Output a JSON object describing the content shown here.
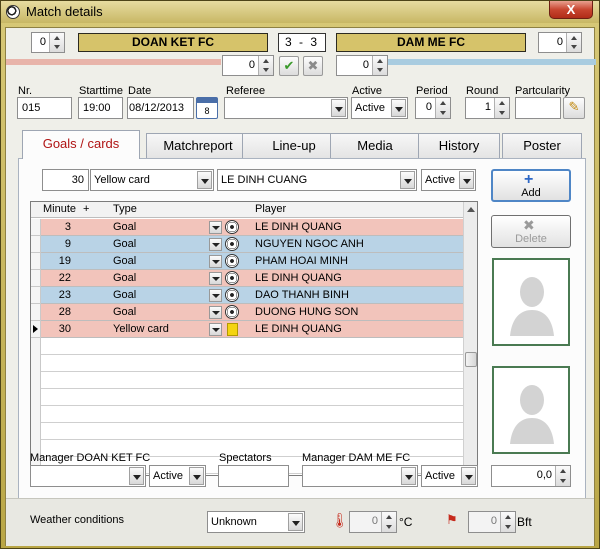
{
  "window": {
    "title": "Match details",
    "close_label": "X"
  },
  "score": {
    "home_team": "DOAN KET FC",
    "away_team": "DAM ME FC",
    "score_text": "3 - 3",
    "home_left_spin": "0",
    "home_sub_spin": "0",
    "away_sub_spin": "0",
    "away_right_spin": "0"
  },
  "info": {
    "nr_label": "Nr.",
    "nr_value": "015",
    "starttime_label": "Starttime",
    "starttime_value": "19:00",
    "date_label": "Date",
    "date_value": "08/12/2013",
    "calendar_badge": "8",
    "referee_label": "Referee",
    "referee_value": "",
    "active_label": "Active",
    "active_value": "Active",
    "period_label": "Period",
    "period_value": "0",
    "round_label": "Round",
    "round_value": "1",
    "particularity_label": "Partcularity",
    "particularity_value": ""
  },
  "tabs": [
    {
      "label": "Goals / cards",
      "active": true
    },
    {
      "label": "Matchreport",
      "active": false
    },
    {
      "label": "Line-up",
      "active": false
    },
    {
      "label": "Media",
      "active": false
    },
    {
      "label": "History",
      "active": false
    },
    {
      "label": "Poster",
      "active": false
    }
  ],
  "entry": {
    "minute": "30",
    "type": "Yellow card",
    "player": "LE DINH CUANG",
    "status": "Active"
  },
  "buttons": {
    "add": "Add",
    "delete": "Delete"
  },
  "grid": {
    "headers": {
      "minute": "Minute",
      "plus": "+",
      "type": "Type",
      "player": "Player"
    },
    "rows": [
      {
        "minute": "3",
        "type": "Goal",
        "player": "LE DINH QUANG",
        "team": "home",
        "icon": "ball"
      },
      {
        "minute": "9",
        "type": "Goal",
        "player": "NGUYEN NGOC ANH",
        "team": "away",
        "icon": "ball"
      },
      {
        "minute": "19",
        "type": "Goal",
        "player": "PHAM HOAI MINH",
        "team": "away",
        "icon": "ball"
      },
      {
        "minute": "22",
        "type": "Goal",
        "player": "LE DINH QUANG",
        "team": "home",
        "icon": "ball"
      },
      {
        "minute": "23",
        "type": "Goal",
        "player": "DAO THANH BINH",
        "team": "away",
        "icon": "ball"
      },
      {
        "minute": "28",
        "type": "Goal",
        "player": "DUONG HUNG SON",
        "team": "home",
        "icon": "ball"
      },
      {
        "minute": "30",
        "type": "Yellow card",
        "player": "LE DINH QUANG",
        "team": "home",
        "icon": "yellow-card",
        "current": true
      }
    ]
  },
  "bottom": {
    "manager_home_label": "Manager DOAN KET FC",
    "manager_home_value": "",
    "manager_home_status": "Active",
    "spectators_label": "Spectators",
    "spectators_value": "",
    "manager_away_label": "Manager DAM ME FC",
    "manager_away_value": "",
    "manager_away_status": "Active",
    "rating_value": "0,0"
  },
  "weather": {
    "label": "Weather conditions",
    "condition": "Unknown",
    "temperature": "0",
    "temperature_unit": "°C",
    "wind": "0",
    "wind_unit": "Bft"
  },
  "colors": {
    "home_row": "#f2c4bb",
    "away_row": "#b9d3e6",
    "accent": "#d6c36a"
  }
}
